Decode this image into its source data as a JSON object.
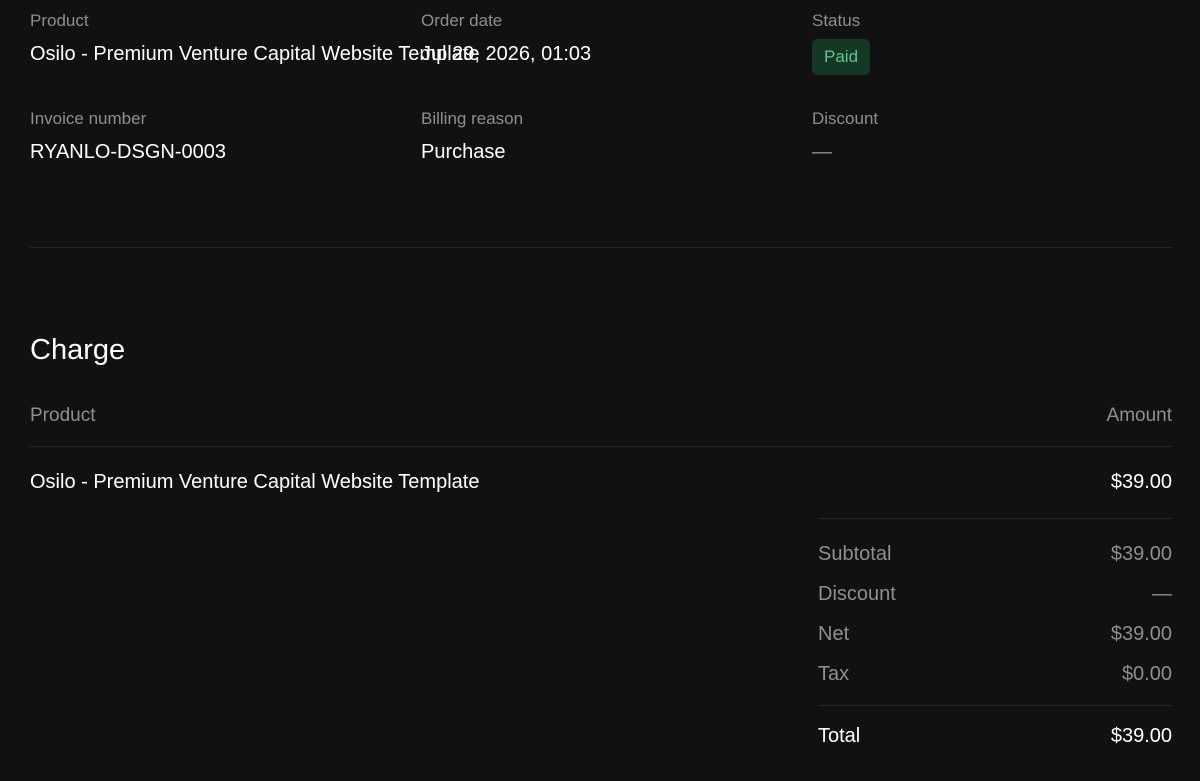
{
  "details": {
    "product_label": "Product",
    "product_value": "Osilo - Premium Venture Capital Website Template",
    "order_date_label": "Order date",
    "order_date_value": "Jul 29, 2026, 01:03",
    "status_label": "Status",
    "status_value": "Paid",
    "invoice_label": "Invoice number",
    "invoice_value": "RYANLO-DSGN-0003",
    "billing_reason_label": "Billing reason",
    "billing_reason_value": "Purchase",
    "discount_label": "Discount",
    "discount_value": "—"
  },
  "charge": {
    "title": "Charge",
    "col_product": "Product",
    "col_amount": "Amount",
    "rows": [
      {
        "product": "Osilo - Premium Venture Capital Website Template",
        "amount": "$39.00"
      }
    ],
    "summary": {
      "subtotal_label": "Subtotal",
      "subtotal_value": "$39.00",
      "discount_label": "Discount",
      "discount_value": "—",
      "net_label": "Net",
      "net_value": "$39.00",
      "tax_label": "Tax",
      "tax_value": "$0.00",
      "total_label": "Total",
      "total_value": "$39.00"
    }
  },
  "colors": {
    "background": "#111111",
    "status_bg": "#143825",
    "status_text": "#5fc78a"
  }
}
